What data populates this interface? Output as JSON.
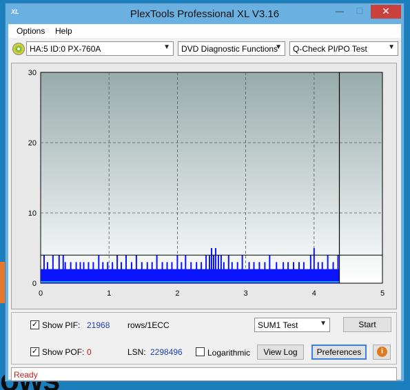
{
  "window": {
    "title": "PlexTools Professional XL V3.16",
    "icon_text": "XL",
    "min_glyph": "—",
    "max_glyph": "☐",
    "close_glyph": "✕"
  },
  "menu": {
    "items": [
      "Options",
      "Help"
    ]
  },
  "toolbar": {
    "drive": "HA:5 ID:0  PX-760A",
    "function": "DVD Diagnostic Functions",
    "test": "Q-Check PI/PO Test"
  },
  "chart_data": {
    "type": "bar",
    "title": "",
    "xlabel": "",
    "ylabel": "",
    "x_ticks": [
      "0",
      "1",
      "2",
      "3",
      "4",
      "5"
    ],
    "y_ticks": [
      "0",
      "10",
      "20",
      "30"
    ],
    "xlim": [
      0,
      5
    ],
    "ylim": [
      0,
      30
    ],
    "grid": true,
    "scan_end_x": 4.37,
    "threshold_y": 4,
    "series": [
      {
        "name": "PIF",
        "color": "#0a14ff",
        "baseline": 2,
        "spikes": [
          [
            0.05,
            4
          ],
          [
            0.1,
            3
          ],
          [
            0.18,
            4
          ],
          [
            0.27,
            4
          ],
          [
            0.33,
            4
          ],
          [
            0.36,
            3
          ],
          [
            0.44,
            3
          ],
          [
            0.52,
            3
          ],
          [
            0.58,
            3
          ],
          [
            0.63,
            3
          ],
          [
            0.7,
            3
          ],
          [
            0.77,
            3
          ],
          [
            0.85,
            4
          ],
          [
            0.91,
            3
          ],
          [
            0.98,
            3
          ],
          [
            1.05,
            3
          ],
          [
            1.12,
            4
          ],
          [
            1.18,
            3
          ],
          [
            1.25,
            4
          ],
          [
            1.33,
            3
          ],
          [
            1.4,
            4
          ],
          [
            1.48,
            3
          ],
          [
            1.56,
            3
          ],
          [
            1.63,
            3
          ],
          [
            1.7,
            4
          ],
          [
            1.78,
            3
          ],
          [
            1.85,
            3
          ],
          [
            1.92,
            3
          ],
          [
            2.0,
            4
          ],
          [
            2.06,
            3
          ],
          [
            2.12,
            4
          ],
          [
            2.2,
            3
          ],
          [
            2.28,
            3
          ],
          [
            2.35,
            3
          ],
          [
            2.42,
            4
          ],
          [
            2.47,
            4
          ],
          [
            2.5,
            5
          ],
          [
            2.53,
            4
          ],
          [
            2.56,
            5
          ],
          [
            2.6,
            4
          ],
          [
            2.64,
            4
          ],
          [
            2.68,
            3
          ],
          [
            2.75,
            4
          ],
          [
            2.8,
            3
          ],
          [
            2.88,
            3
          ],
          [
            2.95,
            4
          ],
          [
            3.05,
            3
          ],
          [
            3.12,
            3
          ],
          [
            3.2,
            3
          ],
          [
            3.28,
            3
          ],
          [
            3.35,
            4
          ],
          [
            3.45,
            3
          ],
          [
            3.55,
            3
          ],
          [
            3.62,
            3
          ],
          [
            3.7,
            3
          ],
          [
            3.78,
            3
          ],
          [
            3.85,
            3
          ],
          [
            3.95,
            4
          ],
          [
            4.0,
            5
          ],
          [
            4.06,
            3
          ],
          [
            4.12,
            3
          ],
          [
            4.2,
            4
          ],
          [
            4.28,
            3
          ],
          [
            4.35,
            4
          ]
        ]
      },
      {
        "name": "POF",
        "color": "#2ec8c8",
        "values": []
      }
    ]
  },
  "controls": {
    "show_pif_label": "Show PIF:",
    "pif_value": "21968",
    "rows_label": "rows/1ECC",
    "show_pof_label": "Show POF:",
    "pof_value": "0",
    "lsn_label": "LSN:",
    "lsn_value": "2298496",
    "logarithmic_label": "Logarithmic",
    "sum_test": "SUM1 Test",
    "start_label": "Start",
    "viewlog_label": "View Log",
    "preferences_label": "Preferences",
    "info_glyph": "i",
    "check_mark": "✓",
    "show_pif_checked": true,
    "show_pof_checked": true,
    "logarithmic_checked": false
  },
  "status": {
    "text": "Ready"
  },
  "desktop": {
    "text": "ows"
  }
}
